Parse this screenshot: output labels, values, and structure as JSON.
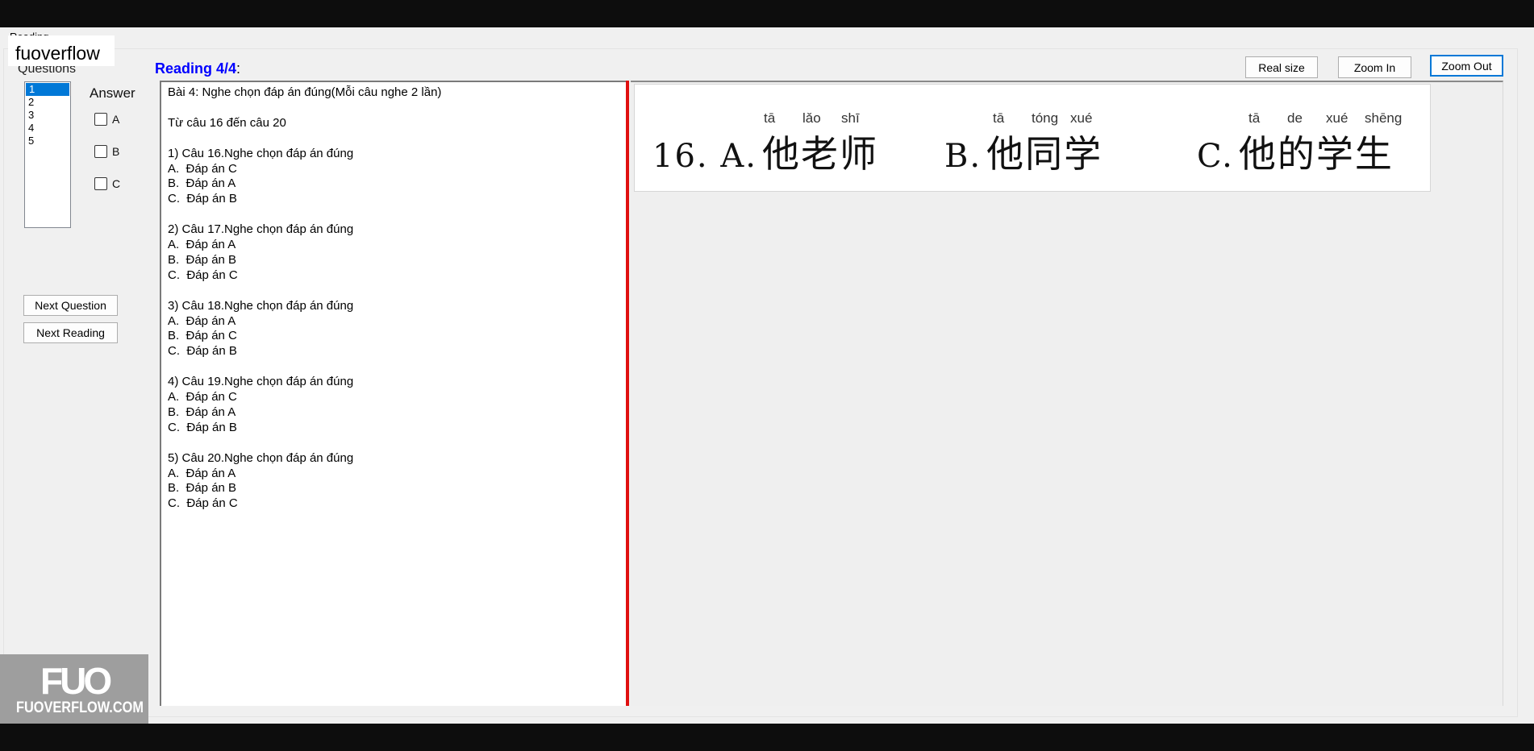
{
  "window": {
    "title": "Reading"
  },
  "watermark": {
    "brand_text": "fuoverflow",
    "logo_text": "FUO",
    "logo_site": "FUOVERFLOW.COM"
  },
  "questions": {
    "label": "Questions",
    "items": [
      "1",
      "2",
      "3",
      "4",
      "5"
    ],
    "selected": "1"
  },
  "answer": {
    "label": "Answer",
    "options": [
      "A",
      "B",
      "C"
    ]
  },
  "buttons": {
    "next_question": "Next Question",
    "next_reading": "Next Reading",
    "real_size": "Real size",
    "zoom_in": "Zoom In",
    "zoom_out": "Zoom Out"
  },
  "reading": {
    "title": "Reading 4/4",
    "title_suffix": ":",
    "lines": [
      "Bài 4: Nghe chọn đáp án đúng(Mỗi câu nghe 2 lần)",
      "",
      "Từ câu 16 đến câu 20",
      "",
      "1) Câu 16.Nghe chọn đáp án đúng",
      "A.  Đáp án C",
      "B.  Đáp án A",
      "C.  Đáp án B",
      "",
      "2) Câu 17.Nghe chọn đáp án đúng",
      "A.  Đáp án A",
      "B.  Đáp án B",
      "C.  Đáp án C",
      "",
      "3) Câu 18.Nghe chọn đáp án đúng",
      "A.  Đáp án A",
      "B.  Đáp án C",
      "C.  Đáp án B",
      "",
      "4) Câu 19.Nghe chọn đáp án đúng",
      "A.  Đáp án C",
      "B.  Đáp án A",
      "C.  Đáp án B",
      "",
      "5) Câu 20.Nghe chọn đáp án đúng",
      "A.  Đáp án A",
      "B.  Đáp án B",
      "C.  Đáp án C"
    ]
  },
  "question_image": {
    "options": [
      {
        "prefix": "16. A.",
        "hanzi": "他老师",
        "pinyin": [
          "tā",
          "lǎo",
          "shī"
        ]
      },
      {
        "prefix": "B.",
        "hanzi": "他同学",
        "pinyin": [
          "tā",
          "tóng",
          "xué"
        ]
      },
      {
        "prefix": "C.",
        "hanzi": "他的学生",
        "pinyin": [
          "tā",
          "de",
          "xué",
          "shēng"
        ]
      }
    ]
  }
}
